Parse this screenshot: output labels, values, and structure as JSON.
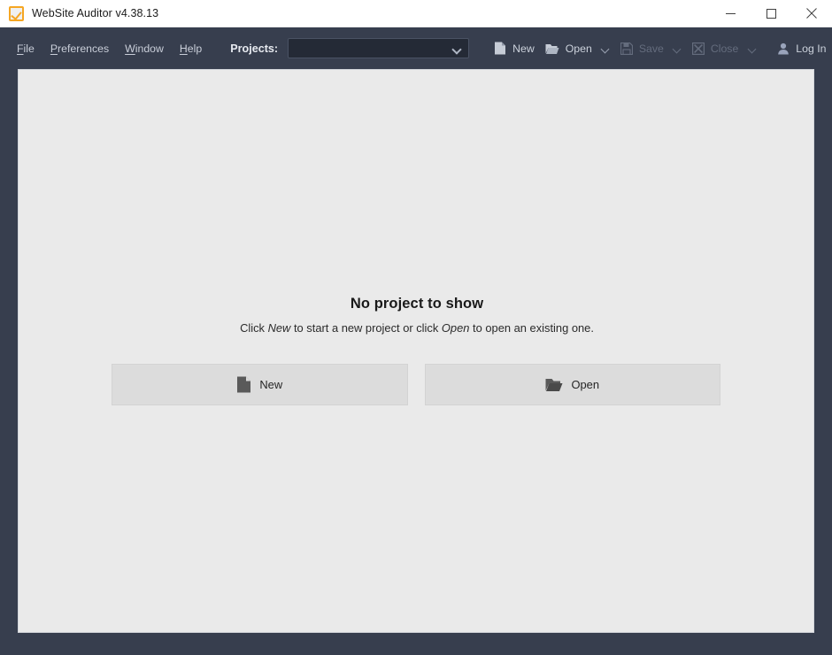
{
  "window": {
    "title": "WebSite Auditor v4.38.13",
    "app_icon": "checkbox-orange-icon",
    "controls": {
      "minimize": "minimize-icon",
      "maximize": "maximize-icon",
      "close": "close-icon"
    }
  },
  "menubar": {
    "items": [
      {
        "label": "File",
        "mnemonic": "F",
        "rest": "ile"
      },
      {
        "label": "Preferences",
        "mnemonic": "P",
        "rest": "references"
      },
      {
        "label": "Window",
        "mnemonic": "W",
        "rest": "indow"
      },
      {
        "label": "Help",
        "mnemonic": "H",
        "rest": "elp"
      }
    ],
    "projects_label": "Projects:",
    "projects_value": "",
    "projects_placeholder": ""
  },
  "toolbar": {
    "new_label": "New",
    "open_label": "Open",
    "save_label": "Save",
    "close_label": "Close",
    "login_label": "Log In",
    "save_disabled": true,
    "close_disabled": true
  },
  "main": {
    "empty_title": "No project to show",
    "empty_hint_part1": "Click ",
    "empty_hint_em1": "New",
    "empty_hint_part2": " to start a new project or click ",
    "empty_hint_em2": "Open",
    "empty_hint_part3": " to open an existing one.",
    "new_button_label": "New",
    "open_button_label": "Open"
  },
  "colors": {
    "chrome_dark": "#373e4e",
    "panel_bg": "#eaeaea",
    "button_bg": "#dcdcdc",
    "accent_orange": "#f5a623",
    "menu_text": "#c9ced9",
    "disabled_text": "#646c7d"
  }
}
